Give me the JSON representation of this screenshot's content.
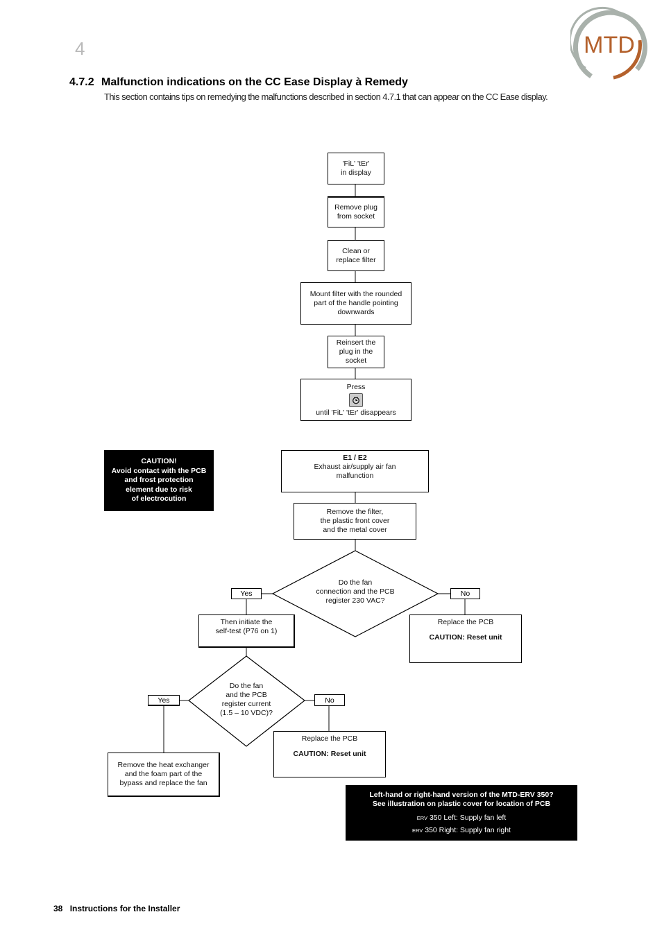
{
  "header": {
    "chapter_number": "4",
    "logo_text": "MTD",
    "section_number": "4.7.2",
    "section_title": "Malfunction indications on the CC Ease Display à Remedy",
    "intro_text": "This section contains tips on remedying the malfunctions described in section 4.7.1 that can appear on the CC Ease display."
  },
  "flow_filter": {
    "start": [
      "'FiL' 'tEr'",
      "in display"
    ],
    "step1": [
      "Remove plug",
      "from socket"
    ],
    "step2": [
      "Clean or",
      "replace filter"
    ],
    "step3": [
      "Mount filter with the rounded",
      "part of the handle pointing",
      "downwards"
    ],
    "step4": [
      "Reinsert the",
      "plug in the",
      "socket"
    ],
    "step5": {
      "line1": "Press",
      "button_icon": "clock-button-icon",
      "line2": "until 'FiL' 'tEr' disappears"
    }
  },
  "caution_box": {
    "lines": [
      "CAUTION!",
      "Avoid contact with the PCB",
      "and frost protection",
      "element due to risk",
      "of electrocution"
    ]
  },
  "flow_fan": {
    "start": {
      "code": "E1 / E2",
      "lines": [
        "Exhaust air/supply air fan",
        "malfunction"
      ]
    },
    "step1": [
      "Remove the filter,",
      "the plastic front cover",
      "and the metal cover"
    ],
    "decision1": [
      "Do the fan",
      "connection and the PCB",
      "register 230 VAC?"
    ],
    "decision1_yes": "Yes",
    "decision1_no": "No",
    "yes1_action": [
      "Then initiate the",
      "self-test (P76 on 1)"
    ],
    "no1_action": {
      "line": "Replace the PCB",
      "caution": "CAUTION: Reset unit"
    },
    "decision2": [
      "Do the fan",
      "and the PCB",
      "register current",
      "(1.5 – 10 VDC)?"
    ],
    "decision2_yes": "Yes",
    "decision2_no": "No",
    "yes2_action": [
      "Remove the heat exchanger",
      "and the foam part of the",
      "bypass and replace the fan"
    ],
    "no2_action": {
      "line": "Replace the PCB",
      "caution": "CAUTION: Reset unit"
    }
  },
  "info_box": {
    "title_lines": [
      "Left-hand or right-hand version of the MTD-ERV 350?",
      "See illustration on plastic cover for location of PCB"
    ],
    "items": [
      {
        "prefix": "ERV",
        "text": "350 Left: Supply fan left"
      },
      {
        "prefix": "ERV",
        "text": "350 Right: Supply fan right"
      }
    ]
  },
  "footer": {
    "page_number": "38",
    "title": "Instructions for the Installer"
  }
}
